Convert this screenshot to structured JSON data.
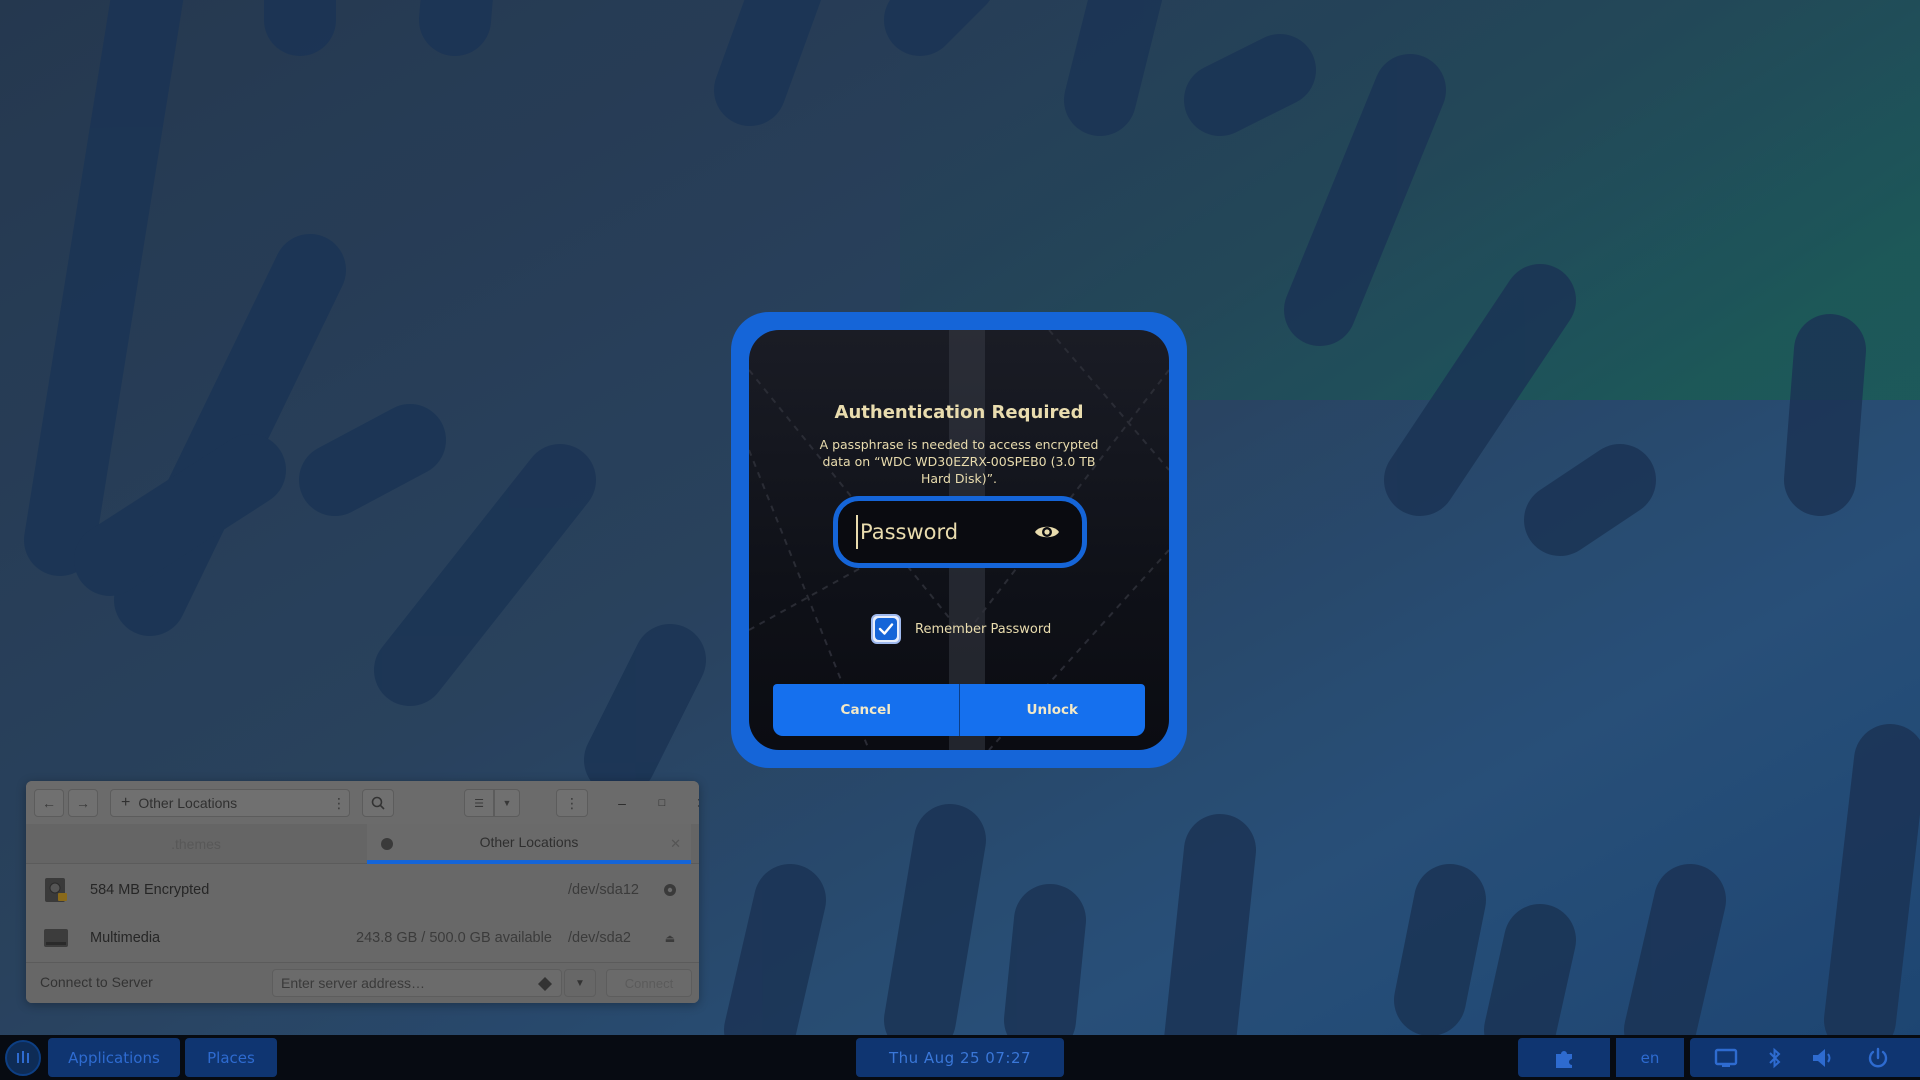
{
  "dialog": {
    "title": "Authentication Required",
    "message": "A passphrase is needed to access encrypted data on “WDC WD30EZRX-00SPEB0 (3.0 TB Hard Disk)”.",
    "password_placeholder": "Password",
    "remember_label": "Remember Password",
    "remember_checked": true,
    "cancel_label": "Cancel",
    "unlock_label": "Unlock",
    "accent_color": "#1565d8",
    "text_color": "#e9dcae"
  },
  "files": {
    "location": "Other Locations",
    "tabs": [
      {
        "label": ".themes"
      },
      {
        "label": "Other Locations",
        "active": true
      }
    ],
    "devices": [
      {
        "name": "584 MB Encrypted",
        "available": "",
        "path": "/dev/sda12",
        "action_icon": "unlock-icon"
      },
      {
        "name": "Multimedia",
        "available": "243.8 GB / 500.0 GB available",
        "path": "/dev/sda2",
        "action_icon": "eject-icon"
      }
    ],
    "connect_label": "Connect to Server",
    "server_placeholder": "Enter server address…",
    "connect_button": "Connect"
  },
  "panel": {
    "applications_label": "Applications",
    "places_label": "Places",
    "clock": "Thu Aug 25  07:27",
    "keyboard_layout": "en",
    "color": "#0f3571"
  }
}
